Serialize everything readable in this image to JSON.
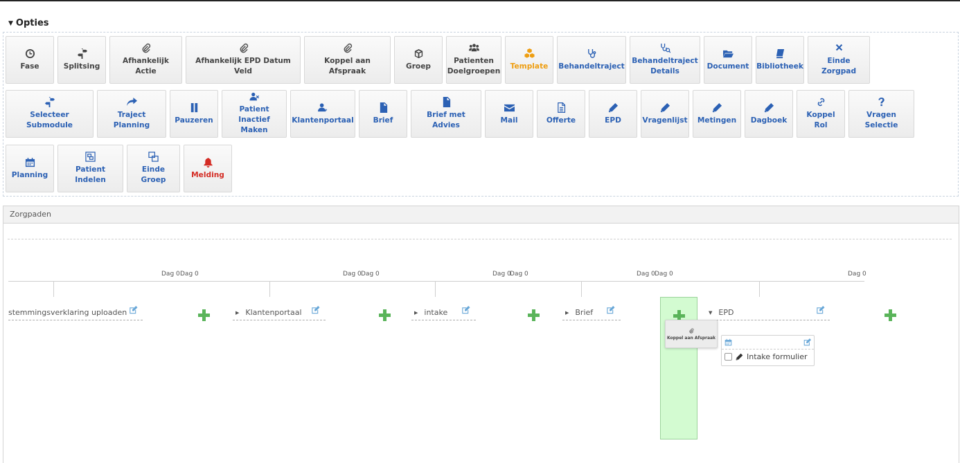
{
  "opties": {
    "title": "Opties"
  },
  "tiles": [
    {
      "label": "Fase",
      "icon": "clock-icon"
    },
    {
      "label": "Splitsing",
      "icon": "signpost-icon"
    },
    {
      "label": "Afhankelijk Actie",
      "icon": "paperclip-icon"
    },
    {
      "label": "Afhankelijk EPD Datum Veld",
      "icon": "paperclip-icon"
    },
    {
      "label": "Koppel aan Afspraak",
      "icon": "paperclip-icon"
    },
    {
      "label": "Groep",
      "icon": "cube-icon"
    },
    {
      "label": "Patienten Doelgroepen",
      "icon": "users-icon"
    },
    {
      "label": "Template",
      "icon": "cubes-icon"
    },
    {
      "label": "Behandeltraject",
      "icon": "stethoscope-icon"
    },
    {
      "label": "Behandeltraject Details",
      "icon": "stethoscope-search-icon"
    },
    {
      "label": "Document",
      "icon": "folder-open-icon"
    },
    {
      "label": "Bibliotheek",
      "icon": "book-icon"
    },
    {
      "label": "Einde Zorgpad",
      "icon": "close-icon"
    },
    {
      "label": "Selecteer Submodule",
      "icon": "signpost-icon"
    },
    {
      "label": "Traject Planning",
      "icon": "share-arrow-icon"
    },
    {
      "label": "Pauzeren",
      "icon": "pause-icon"
    },
    {
      "label": "Patient Inactief Maken",
      "icon": "user-remove-icon"
    },
    {
      "label": "Klantenportaal",
      "icon": "user-portal-icon"
    },
    {
      "label": "Brief",
      "icon": "file-text-icon"
    },
    {
      "label": "Brief met Advies",
      "icon": "file-text-icon"
    },
    {
      "label": "Mail",
      "icon": "envelope-icon"
    },
    {
      "label": "Offerte",
      "icon": "file-outline-icon"
    },
    {
      "label": "EPD",
      "icon": "pencil-icon"
    },
    {
      "label": "Vragenlijst",
      "icon": "pencil-icon"
    },
    {
      "label": "Metingen",
      "icon": "pencil-icon"
    },
    {
      "label": "Dagboek",
      "icon": "pencil-icon"
    },
    {
      "label": "Koppel Rol",
      "icon": "link-icon"
    },
    {
      "label": "Vragen Selectie",
      "icon": "question-icon"
    },
    {
      "label": "Planning",
      "icon": "calendar-icon"
    },
    {
      "label": "Patient Indelen",
      "icon": "object-group-icon"
    },
    {
      "label": "Einde Groep",
      "icon": "object-ungroup-icon"
    },
    {
      "label": "Melding",
      "icon": "bell-icon"
    }
  ],
  "zorgpaden": {
    "title": "Zorgpaden"
  },
  "timeline": {
    "dag_labels": [
      "Dag 0",
      "Dag 0",
      "Dag 0",
      "Dag 0",
      "Dag 0",
      "Dag 0",
      "Dag 0",
      "Dag 0",
      "Dag 0"
    ],
    "steps": [
      {
        "label": "stemmingsverklaring uploaden",
        "expanded": null
      },
      {
        "label": "Klantenportaal",
        "expanded": false
      },
      {
        "label": "intake",
        "expanded": false
      },
      {
        "label": "Brief",
        "expanded": false
      },
      {
        "label": "EPD",
        "expanded": true
      }
    ],
    "drag_card": {
      "label": "Koppel aan Afspraak"
    },
    "epd_item": {
      "label": "Intake formulier"
    }
  },
  "colors": {
    "blue": "#2c61b4",
    "orange": "#ee9e12",
    "red": "#d42c24",
    "green": "#5ab45a",
    "drop_zone": "#d3fbd1"
  }
}
